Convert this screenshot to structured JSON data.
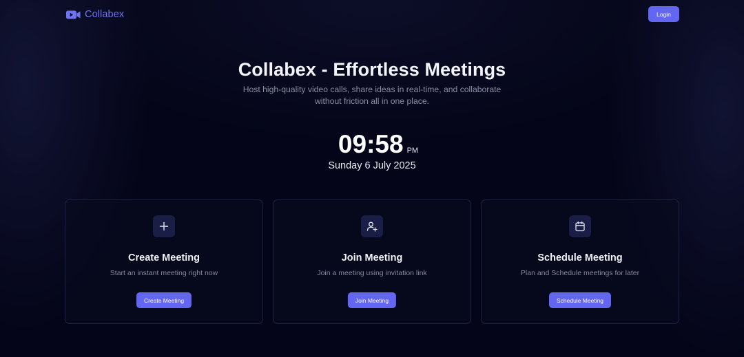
{
  "header": {
    "brand_name": "Collabex",
    "brand_icon": "video-camera-icon",
    "login_label": "Login"
  },
  "hero": {
    "title": "Collabex - Effortless Meetings",
    "subtitle": "Host high-quality video calls, share ideas in real-time, and collaborate without friction all in one place."
  },
  "clock": {
    "time": "09:58",
    "ampm": "PM",
    "date": "Sunday 6 July 2025"
  },
  "cards": [
    {
      "icon": "plus-icon",
      "title": "Create Meeting",
      "description": "Start an instant meeting right now",
      "button_label": "Create Meeting"
    },
    {
      "icon": "user-plus-icon",
      "title": "Join Meeting",
      "description": "Join a meeting using invitation link",
      "button_label": "Join Meeting"
    },
    {
      "icon": "calendar-icon",
      "title": "Schedule Meeting",
      "description": "Plan and Schedule meetings for later",
      "button_label": "Schedule Meeting"
    }
  ],
  "colors": {
    "accent": "#6366f1",
    "brand_text": "#6f73f2",
    "background": "#040518",
    "card_border": "#1e2346",
    "icon_box": "#1a1d46"
  }
}
